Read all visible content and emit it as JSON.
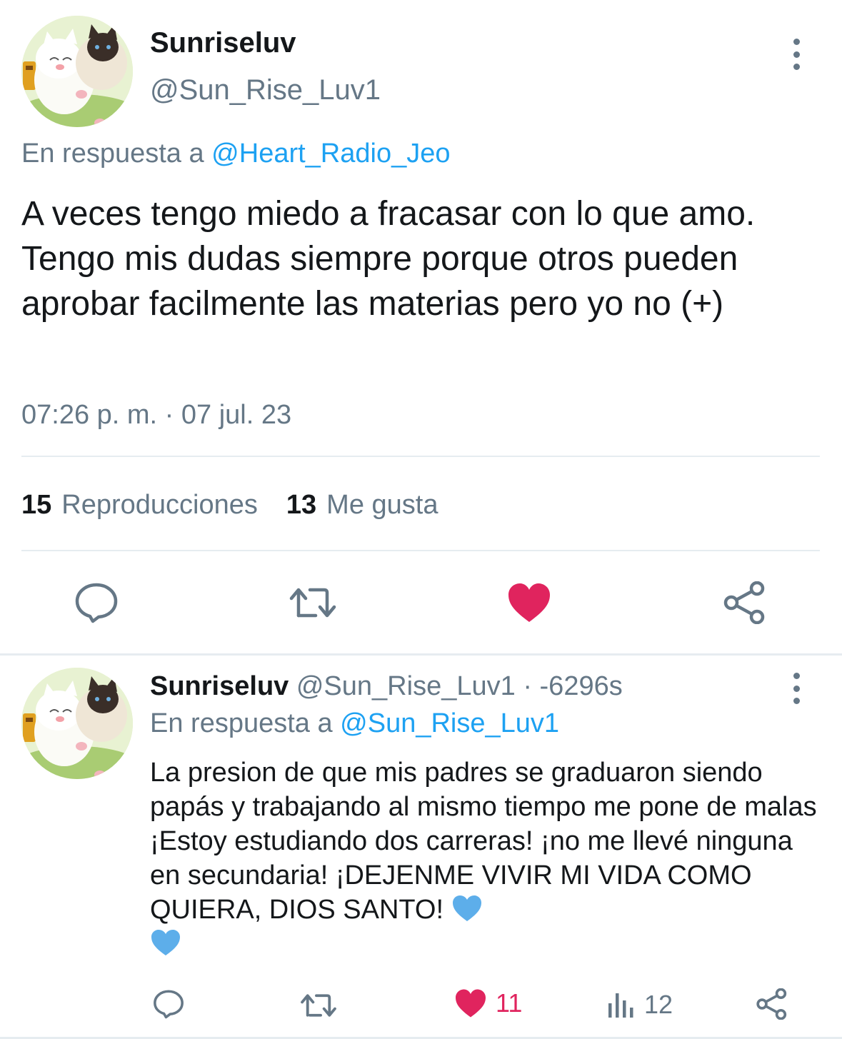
{
  "main_tweet": {
    "display_name": "Sunriseluv",
    "handle": "@Sun_Rise_Luv1",
    "reply_prefix": "En respuesta a",
    "reply_mention": "@Heart_Radio_Jeo",
    "text": "A veces tengo miedo a fracasar con lo que amo. Tengo mis dudas siempre porque otros pueden aprobar facilmente las materias pero yo no (+)",
    "timestamp": "07:26 p. m. · 07 jul. 23",
    "stats": {
      "views_count": "15",
      "views_label": "Reproducciones",
      "likes_count": "13",
      "likes_label": "Me gusta"
    },
    "actions": [
      "reply-icon",
      "retweet-icon",
      "heart-icon",
      "share-icon"
    ],
    "liked": true
  },
  "reply_tweet": {
    "display_name": "Sunriseluv",
    "handle": "@Sun_Rise_Luv1",
    "time": "· -6296s",
    "reply_prefix": "En respuesta a",
    "reply_mention": "@Sun_Rise_Luv1",
    "text": "La presion de que mis padres se graduaron siendo papás y trabajando al mismo tiempo me pone de malas ¡Estoy estudiando dos carreras! ¡no me llevé ninguna en secundaria! ¡DEJENME VIVIR MI VIDA COMO QUIERA, DIOS SANTO!",
    "like_count": "11",
    "views_count": "12",
    "liked": true
  },
  "colors": {
    "accent": "#1da1f2",
    "like": "#e0245e",
    "muted": "#657786",
    "text": "#14171a",
    "emoji_heart": "#5daeea"
  }
}
